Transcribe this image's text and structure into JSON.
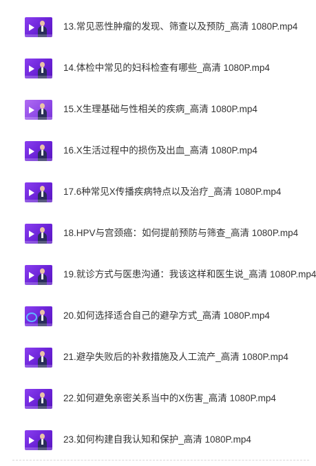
{
  "files": [
    {
      "name": "13.常见恶性肿瘤的发现、筛查以及预防_高清 1080P.mp4",
      "icon": "video-thumbnail-icon"
    },
    {
      "name": "14.体检中常见的妇科检查有哪些_高清 1080P.mp4",
      "icon": "video-thumbnail-icon"
    },
    {
      "name": "15.X生理基础与性相关的疾病_高清 1080P.mp4",
      "icon": "video-thumbnail-icon"
    },
    {
      "name": "16.X生活过程中的损伤及出血_高清 1080P.mp4",
      "icon": "video-thumbnail-icon"
    },
    {
      "name": "17.6种常见X传播疾病特点以及治疗_高清 1080P.mp4",
      "icon": "video-thumbnail-icon"
    },
    {
      "name": "18.HPV与宫颈癌：如何提前预防与筛查_高清 1080P.mp4",
      "icon": "video-thumbnail-icon"
    },
    {
      "name": "19.就诊方式与医患沟通：我该这样和医生说_高清 1080P.mp4",
      "icon": "video-thumbnail-icon"
    },
    {
      "name": "20.如何选择适合自己的避孕方式_高清 1080P.mp4",
      "icon": "video-thumbnail-icon"
    },
    {
      "name": "21.避孕失败后的补救措施及人工流产_高清 1080P.mp4",
      "icon": "video-thumbnail-icon"
    },
    {
      "name": "22.如何避免亲密关系当中的X伤害_高清 1080P.mp4",
      "icon": "video-thumbnail-icon"
    },
    {
      "name": "23.如何构建自我认知和保护_高清 1080P.mp4",
      "icon": "video-thumbnail-icon"
    }
  ],
  "colors": {
    "thumbnail_purple": "#6a22d6",
    "text": "#333333",
    "divider": "#d6d6d6"
  }
}
